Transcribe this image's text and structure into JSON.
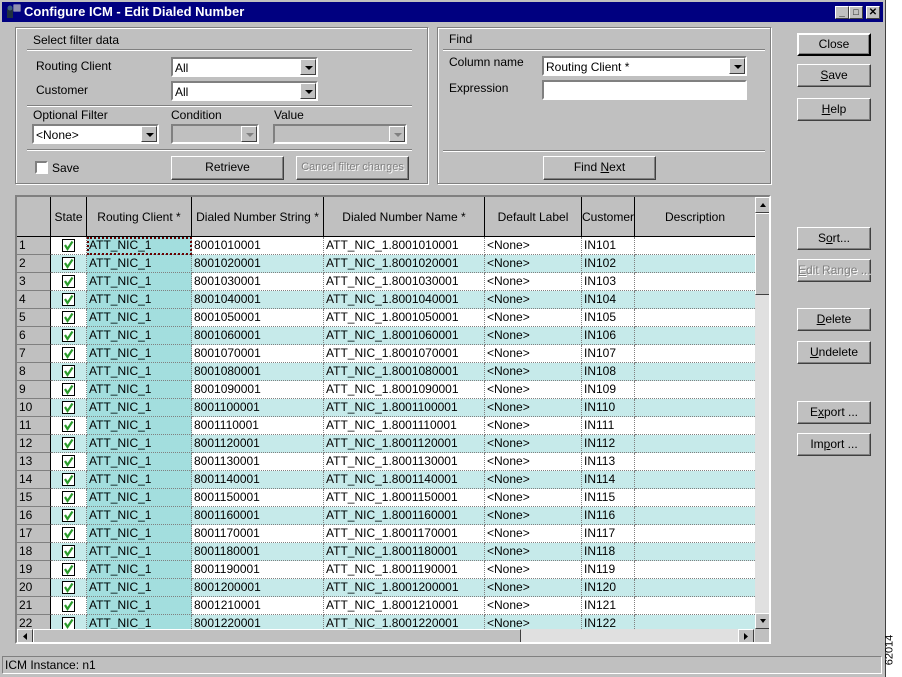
{
  "window": {
    "title": "Configure ICM -  Edit Dialed Number",
    "controls": {
      "minimize": "_",
      "maximize": "□",
      "close": "✕"
    }
  },
  "filter": {
    "group_label": "Select filter data",
    "routing_client_label": "Routing Client",
    "routing_client_value": "All",
    "customer_label": "Customer",
    "customer_value": "All",
    "optional_filter_label": "Optional Filter",
    "optional_filter_value": "<None>",
    "condition_label": "Condition",
    "condition_value": "",
    "value_label": "Value",
    "value_value": "",
    "save_label": "Save",
    "save_checked": false,
    "retrieve_label": "Retrieve",
    "cancel_label": "Cancel filter changes"
  },
  "find": {
    "group_label": "Find",
    "column_name_label": "Column name",
    "column_name_value": "Routing Client  *",
    "expression_label": "Expression",
    "expression_value": "",
    "find_next_label": "Find Next"
  },
  "buttons": {
    "close": "Close",
    "save": "Save",
    "help": "Help",
    "sort": "Sort...",
    "edit_range": "Edit Range ...",
    "delete": "Delete",
    "undelete": "Undelete",
    "export": "Export ...",
    "import": "Import ..."
  },
  "grid": {
    "columns": [
      "",
      "State",
      "Routing Client  *",
      "Dialed Number String *",
      "Dialed Number Name *",
      "Default Label",
      "Customer",
      "Description"
    ],
    "rows": [
      {
        "n": "1",
        "state": "checked",
        "rc": "ATT_NIC_1",
        "dns": "8001010001",
        "dnn": "ATT_NIC_1.8001010001",
        "label": "<None>",
        "cust": "IN101",
        "desc": ""
      },
      {
        "n": "2",
        "state": "checked",
        "rc": "ATT_NIC_1",
        "dns": "8001020001",
        "dnn": "ATT_NIC_1.8001020001",
        "label": "<None>",
        "cust": "IN102",
        "desc": ""
      },
      {
        "n": "3",
        "state": "checked",
        "rc": "ATT_NIC_1",
        "dns": "8001030001",
        "dnn": "ATT_NIC_1.8001030001",
        "label": "<None>",
        "cust": "IN103",
        "desc": ""
      },
      {
        "n": "4",
        "state": "checked",
        "rc": "ATT_NIC_1",
        "dns": "8001040001",
        "dnn": "ATT_NIC_1.8001040001",
        "label": "<None>",
        "cust": "IN104",
        "desc": ""
      },
      {
        "n": "5",
        "state": "checked",
        "rc": "ATT_NIC_1",
        "dns": "8001050001",
        "dnn": "ATT_NIC_1.8001050001",
        "label": "<None>",
        "cust": "IN105",
        "desc": ""
      },
      {
        "n": "6",
        "state": "checked",
        "rc": "ATT_NIC_1",
        "dns": "8001060001",
        "dnn": "ATT_NIC_1.8001060001",
        "label": "<None>",
        "cust": "IN106",
        "desc": ""
      },
      {
        "n": "7",
        "state": "checked",
        "rc": "ATT_NIC_1",
        "dns": "8001070001",
        "dnn": "ATT_NIC_1.8001070001",
        "label": "<None>",
        "cust": "IN107",
        "desc": ""
      },
      {
        "n": "8",
        "state": "checked",
        "rc": "ATT_NIC_1",
        "dns": "8001080001",
        "dnn": "ATT_NIC_1.8001080001",
        "label": "<None>",
        "cust": "IN108",
        "desc": ""
      },
      {
        "n": "9",
        "state": "checked",
        "rc": "ATT_NIC_1",
        "dns": "8001090001",
        "dnn": "ATT_NIC_1.8001090001",
        "label": "<None>",
        "cust": "IN109",
        "desc": ""
      },
      {
        "n": "10",
        "state": "checked",
        "rc": "ATT_NIC_1",
        "dns": "8001100001",
        "dnn": "ATT_NIC_1.8001100001",
        "label": "<None>",
        "cust": "IN110",
        "desc": ""
      },
      {
        "n": "11",
        "state": "checked",
        "rc": "ATT_NIC_1",
        "dns": "8001110001",
        "dnn": "ATT_NIC_1.8001110001",
        "label": "<None>",
        "cust": "IN111",
        "desc": ""
      },
      {
        "n": "12",
        "state": "checked",
        "rc": "ATT_NIC_1",
        "dns": "8001120001",
        "dnn": "ATT_NIC_1.8001120001",
        "label": "<None>",
        "cust": "IN112",
        "desc": ""
      },
      {
        "n": "13",
        "state": "checked",
        "rc": "ATT_NIC_1",
        "dns": "8001130001",
        "dnn": "ATT_NIC_1.8001130001",
        "label": "<None>",
        "cust": "IN113",
        "desc": ""
      },
      {
        "n": "14",
        "state": "checked",
        "rc": "ATT_NIC_1",
        "dns": "8001140001",
        "dnn": "ATT_NIC_1.8001140001",
        "label": "<None>",
        "cust": "IN114",
        "desc": ""
      },
      {
        "n": "15",
        "state": "checked",
        "rc": "ATT_NIC_1",
        "dns": "8001150001",
        "dnn": "ATT_NIC_1.8001150001",
        "label": "<None>",
        "cust": "IN115",
        "desc": ""
      },
      {
        "n": "16",
        "state": "checked",
        "rc": "ATT_NIC_1",
        "dns": "8001160001",
        "dnn": "ATT_NIC_1.8001160001",
        "label": "<None>",
        "cust": "IN116",
        "desc": ""
      },
      {
        "n": "17",
        "state": "checked",
        "rc": "ATT_NIC_1",
        "dns": "8001170001",
        "dnn": "ATT_NIC_1.8001170001",
        "label": "<None>",
        "cust": "IN117",
        "desc": ""
      },
      {
        "n": "18",
        "state": "checked",
        "rc": "ATT_NIC_1",
        "dns": "8001180001",
        "dnn": "ATT_NIC_1.8001180001",
        "label": "<None>",
        "cust": "IN118",
        "desc": ""
      },
      {
        "n": "19",
        "state": "checked",
        "rc": "ATT_NIC_1",
        "dns": "8001190001",
        "dnn": "ATT_NIC_1.8001190001",
        "label": "<None>",
        "cust": "IN119",
        "desc": ""
      },
      {
        "n": "20",
        "state": "checked",
        "rc": "ATT_NIC_1",
        "dns": "8001200001",
        "dnn": "ATT_NIC_1.8001200001",
        "label": "<None>",
        "cust": "IN120",
        "desc": ""
      },
      {
        "n": "21",
        "state": "checked",
        "rc": "ATT_NIC_1",
        "dns": "8001210001",
        "dnn": "ATT_NIC_1.8001210001",
        "label": "<None>",
        "cust": "IN121",
        "desc": ""
      },
      {
        "n": "22",
        "state": "checked",
        "rc": "ATT_NIC_1",
        "dns": "8001220001",
        "dnn": "ATT_NIC_1.8001220001",
        "label": "<None>",
        "cust": "IN122",
        "desc": ""
      }
    ]
  },
  "status": {
    "text": "ICM Instance: n1"
  },
  "figure_code": "62014",
  "colors": {
    "titlebar": "#000080",
    "check": "#2a9a2a",
    "row_alt": "#d8f0f0"
  }
}
